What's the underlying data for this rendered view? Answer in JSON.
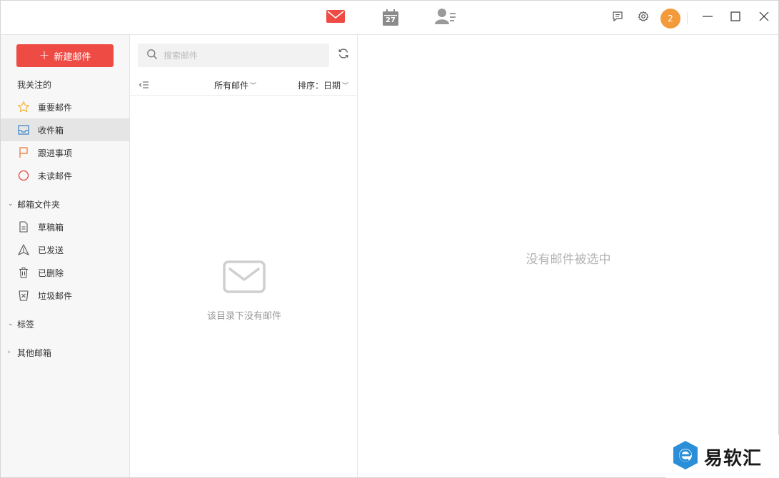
{
  "titlebar": {
    "tabs": [
      {
        "name": "mail",
        "icon": "mail-icon",
        "active": true
      },
      {
        "name": "calendar",
        "icon": "calendar-icon",
        "day": "27"
      },
      {
        "name": "contacts",
        "icon": "contacts-icon"
      }
    ],
    "avatar_text": "2",
    "colors": {
      "accent": "#ef4b45",
      "avatar": "#f39a3a"
    }
  },
  "sidebar": {
    "compose_label": "新建邮件",
    "favorites_title": "我关注的",
    "favorites": [
      {
        "label": "重要邮件",
        "icon": "star-icon"
      },
      {
        "label": "收件箱",
        "icon": "inbox-icon",
        "active": true
      },
      {
        "label": "跟进事项",
        "icon": "flag-icon"
      },
      {
        "label": "未读邮件",
        "icon": "unread-circle-icon"
      }
    ],
    "folders_title": "邮箱文件夹",
    "folders": [
      {
        "label": "草稿箱",
        "icon": "draft-icon"
      },
      {
        "label": "已发送",
        "icon": "sent-icon"
      },
      {
        "label": "已删除",
        "icon": "trash-icon"
      },
      {
        "label": "垃圾邮件",
        "icon": "spam-icon"
      }
    ],
    "tags_title": "标签",
    "other_title": "其他邮箱"
  },
  "list": {
    "search_placeholder": "搜索邮件",
    "filter_label": "所有邮件",
    "sort_label": "排序：日期",
    "empty_text": "该目录下没有邮件"
  },
  "reader": {
    "empty_text": "没有邮件被选中"
  },
  "watermark": {
    "text": "易软汇"
  }
}
